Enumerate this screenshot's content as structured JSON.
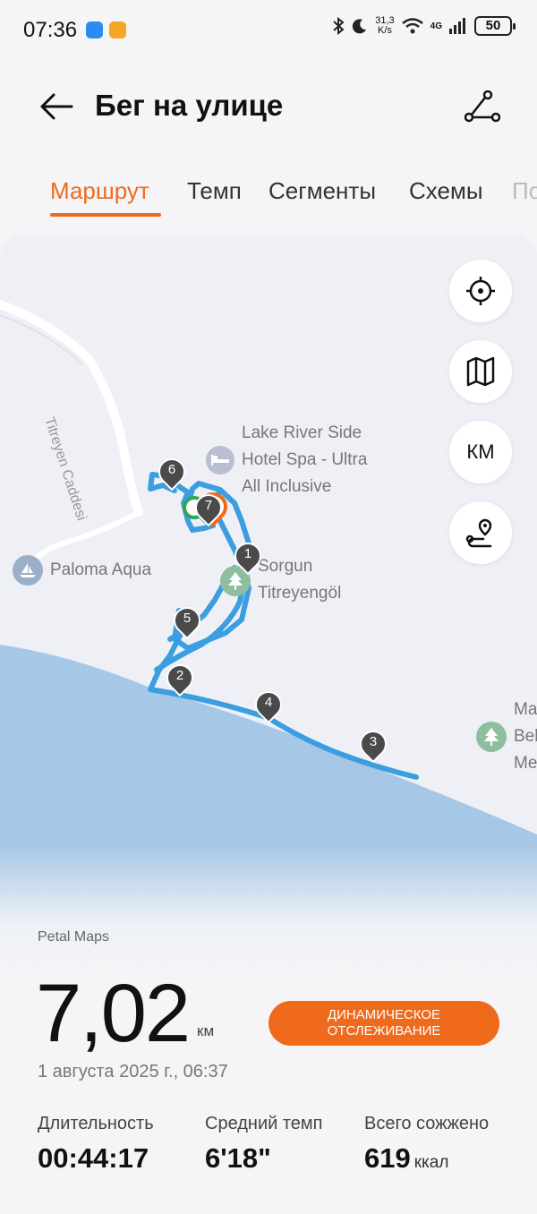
{
  "status_bar": {
    "time": "07:36",
    "net_speed_top": "31,3",
    "net_speed_bottom": "K/s",
    "network": "4G",
    "battery": "50"
  },
  "header": {
    "title": "Бег на улице"
  },
  "tabs": [
    "Маршрут",
    "Темп",
    "Сегменты",
    "Схемы",
    "По"
  ],
  "map": {
    "road_label": "Titreyen Caddesi",
    "places": {
      "hotel": [
        "Lake River Side",
        "Hotel Spa - Ultra",
        "All Inclusive"
      ],
      "aqua": "Paloma Aqua",
      "park": [
        "Sorgun",
        "Titreyengöl"
      ],
      "edge_park": [
        "Ma",
        "Bel",
        "Me"
      ]
    },
    "km_markers": [
      "1",
      "2",
      "3",
      "4",
      "5",
      "6",
      "7"
    ],
    "controls": {
      "km_label": "КМ"
    },
    "colors": {
      "route": "#3a9ee0",
      "sea": "#a7c7e6",
      "land": "#eff0f6",
      "accent": "#f06a1b"
    }
  },
  "summary": {
    "provider": "Petal Maps",
    "distance": "7,02",
    "distance_unit": "км",
    "live_tracking_button": "ДИНАМИЧЕСКОЕ ОТСЛЕЖИВАНИЕ",
    "date": "1 августа 2025 г., 06:37"
  },
  "stats": [
    {
      "label": "Длительность",
      "value": "00:44:17",
      "unit": ""
    },
    {
      "label": "Средний темп",
      "value": "6'18\"",
      "unit": ""
    },
    {
      "label": "Всего сожжено",
      "value": "619",
      "unit": "ккал"
    }
  ]
}
